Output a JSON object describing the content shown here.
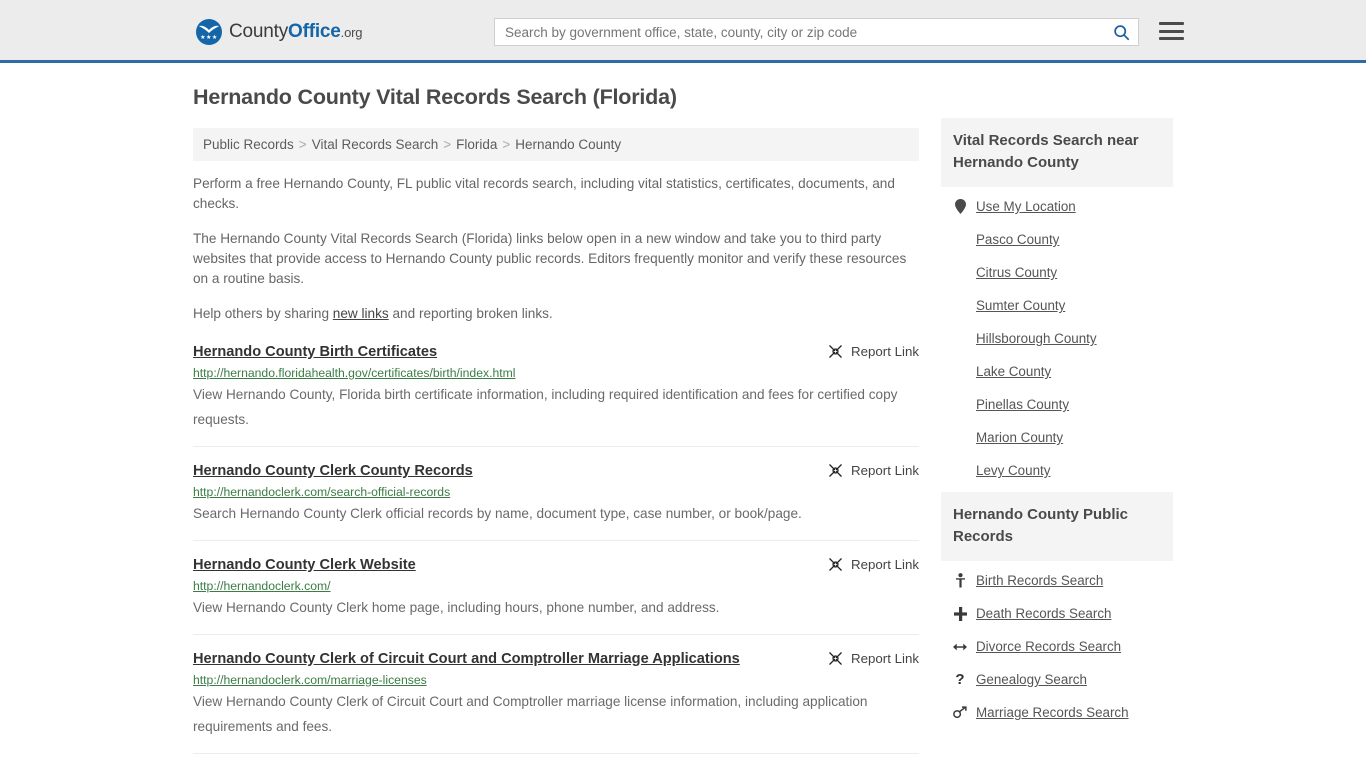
{
  "header": {
    "logo": {
      "text_a": "County",
      "text_b": "Office",
      "text_domain": ".org",
      "mark_icon": "eagle-crest-icon",
      "brand_color": "#1566a8"
    },
    "search": {
      "placeholder": "Search by government office, state, county, city or zip code",
      "value": "",
      "button_icon": "search-icon"
    },
    "menu_icon": "hamburger-menu-icon",
    "accent_border_color": "#2f6ca3",
    "background_color": "#ececec"
  },
  "main": {
    "title": "Hernando County Vital Records Search (Florida)",
    "breadcrumb": {
      "separator": ">",
      "items": [
        {
          "label": "Public Records"
        },
        {
          "label": "Vital Records Search"
        },
        {
          "label": "Florida"
        },
        {
          "label": "Hernando County"
        }
      ]
    },
    "intro": {
      "paragraph_1": "Perform a free Hernando County, FL public vital records search, including vital statistics, certificates, documents, and checks.",
      "paragraph_2": "The Hernando County Vital Records Search (Florida) links below open in a new window and take you to third party websites that provide access to Hernando County public records. Editors frequently monitor and verify these resources on a routine basis.",
      "paragraph_3_pre": "Help others by sharing ",
      "paragraph_3_link": "new links",
      "paragraph_3_post": " and reporting broken links."
    },
    "report_link_label": "Report Link",
    "report_link_icon": "broken-link-icon",
    "results": [
      {
        "title": "Hernando County Birth Certificates",
        "url": "http://hernando.floridahealth.gov/certificates/birth/index.html",
        "description": "View Hernando County, Florida birth certificate information, including required identification and fees for certified copy requests."
      },
      {
        "title": "Hernando County Clerk County Records",
        "url": "http://hernandoclerk.com/search-official-records",
        "description": "Search Hernando County Clerk official records by name, document type, case number, or book/page."
      },
      {
        "title": "Hernando County Clerk Website",
        "url": "http://hernandoclerk.com/",
        "description": "View Hernando County Clerk home page, including hours, phone number, and address."
      },
      {
        "title": "Hernando County Clerk of Circuit Court and Comptroller Marriage Applications",
        "url": "http://hernandoclerk.com/marriage-licenses",
        "description": "View Hernando County Clerk of Circuit Court and Comptroller marriage license information, including application requirements and fees."
      }
    ]
  },
  "sidebar": {
    "panels": [
      {
        "heading": "Vital Records Search near Hernando County",
        "items": [
          {
            "label": "Use My Location",
            "icon": "map-pin-icon"
          },
          {
            "label": "Pasco County",
            "icon": ""
          },
          {
            "label": "Citrus County",
            "icon": ""
          },
          {
            "label": "Sumter County",
            "icon": ""
          },
          {
            "label": "Hillsborough County",
            "icon": ""
          },
          {
            "label": "Lake County",
            "icon": ""
          },
          {
            "label": "Pinellas County",
            "icon": ""
          },
          {
            "label": "Marion County",
            "icon": ""
          },
          {
            "label": "Levy County",
            "icon": ""
          }
        ]
      },
      {
        "heading": "Hernando County Public Records",
        "items": [
          {
            "label": "Birth Records Search",
            "icon": "baby-icon"
          },
          {
            "label": "Death Records Search",
            "icon": "cross-icon"
          },
          {
            "label": "Divorce Records Search",
            "icon": "double-arrow-icon"
          },
          {
            "label": "Genealogy Search",
            "icon": "question-mark-icon"
          },
          {
            "label": "Marriage Records Search",
            "icon": "gender-symbols-icon"
          }
        ]
      }
    ]
  }
}
